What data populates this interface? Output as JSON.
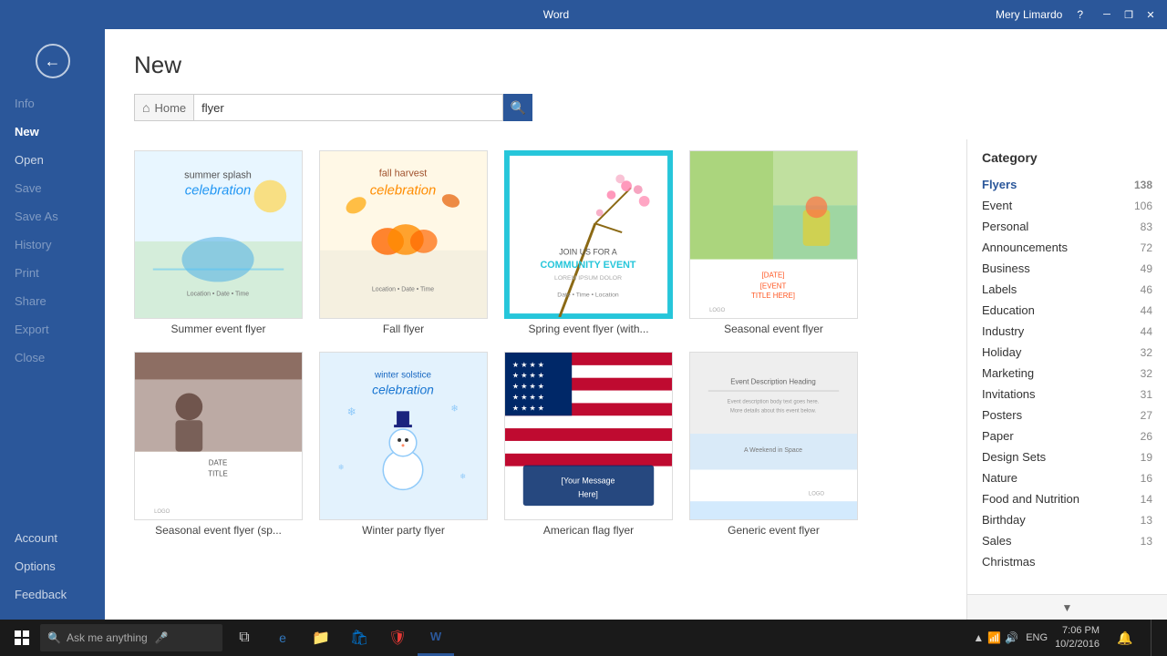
{
  "titlebar": {
    "app_name": "Word",
    "user": "Mery Limardo",
    "help_label": "?",
    "minimize": "─",
    "restore": "❐",
    "close": "✕"
  },
  "sidebar": {
    "back_label": "←",
    "items": [
      {
        "id": "info",
        "label": "Info",
        "active": false,
        "disabled": true
      },
      {
        "id": "new",
        "label": "New",
        "active": true,
        "disabled": false
      },
      {
        "id": "open",
        "label": "Open",
        "active": false,
        "disabled": false
      },
      {
        "id": "save",
        "label": "Save",
        "active": false,
        "disabled": true
      },
      {
        "id": "save-as",
        "label": "Save As",
        "active": false,
        "disabled": true
      },
      {
        "id": "history",
        "label": "History",
        "active": false,
        "disabled": true
      },
      {
        "id": "print",
        "label": "Print",
        "active": false,
        "disabled": true
      },
      {
        "id": "share",
        "label": "Share",
        "active": false,
        "disabled": true
      },
      {
        "id": "export",
        "label": "Export",
        "active": false,
        "disabled": true
      },
      {
        "id": "close",
        "label": "Close",
        "active": false,
        "disabled": true
      }
    ],
    "bottom_items": [
      {
        "id": "account",
        "label": "Account"
      },
      {
        "id": "options",
        "label": "Options"
      },
      {
        "id": "feedback",
        "label": "Feedback"
      }
    ]
  },
  "header": {
    "title": "New",
    "search": {
      "home_label": "Home",
      "placeholder": "flyer",
      "value": "flyer",
      "search_icon": "🔍"
    }
  },
  "templates": [
    {
      "id": "summer-event",
      "name": "Summer event flyer",
      "style": "summer"
    },
    {
      "id": "fall-flyer",
      "name": "Fall flyer",
      "style": "fall"
    },
    {
      "id": "spring-event",
      "name": "Spring event flyer (with...",
      "style": "spring"
    },
    {
      "id": "seasonal-event1",
      "name": "Seasonal event flyer",
      "style": "seasonal1"
    },
    {
      "id": "seasonal-event2",
      "name": "Seasonal event flyer (sp...",
      "style": "seasonal2"
    },
    {
      "id": "winter-party",
      "name": "Winter party flyer",
      "style": "winter"
    },
    {
      "id": "american-flag",
      "name": "American flag flyer",
      "style": "american"
    },
    {
      "id": "generic-event",
      "name": "Generic event flyer",
      "style": "generic"
    }
  ],
  "categories": {
    "title": "Category",
    "items": [
      {
        "name": "Flyers",
        "count": 138,
        "selected": true
      },
      {
        "name": "Event",
        "count": 106,
        "selected": false
      },
      {
        "name": "Personal",
        "count": 83,
        "selected": false
      },
      {
        "name": "Announcements",
        "count": 72,
        "selected": false
      },
      {
        "name": "Business",
        "count": 49,
        "selected": false
      },
      {
        "name": "Labels",
        "count": 46,
        "selected": false
      },
      {
        "name": "Education",
        "count": 44,
        "selected": false
      },
      {
        "name": "Industry",
        "count": 44,
        "selected": false
      },
      {
        "name": "Holiday",
        "count": 32,
        "selected": false
      },
      {
        "name": "Marketing",
        "count": 32,
        "selected": false
      },
      {
        "name": "Invitations",
        "count": 31,
        "selected": false
      },
      {
        "name": "Posters",
        "count": 27,
        "selected": false
      },
      {
        "name": "Paper",
        "count": 26,
        "selected": false
      },
      {
        "name": "Design Sets",
        "count": 19,
        "selected": false
      },
      {
        "name": "Nature",
        "count": 16,
        "selected": false
      },
      {
        "name": "Food and Nutrition",
        "count": 14,
        "selected": false
      },
      {
        "name": "Birthday",
        "count": 13,
        "selected": false
      },
      {
        "name": "Sales",
        "count": 13,
        "selected": false
      },
      {
        "name": "Christmas",
        "count": "",
        "selected": false
      }
    ]
  },
  "taskbar": {
    "search_placeholder": "Ask me anything",
    "time": "7:06 PM",
    "date": "10/2/2016",
    "language": "ENG"
  }
}
